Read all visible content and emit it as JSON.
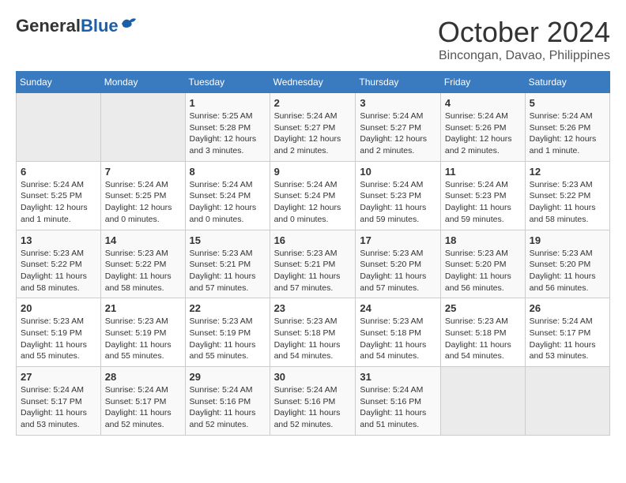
{
  "header": {
    "logo": {
      "general": "General",
      "blue": "Blue"
    },
    "title": "October 2024",
    "location": "Bincongan, Davao, Philippines"
  },
  "weekdays": [
    "Sunday",
    "Monday",
    "Tuesday",
    "Wednesday",
    "Thursday",
    "Friday",
    "Saturday"
  ],
  "weeks": [
    [
      {
        "day": "",
        "sunrise": "",
        "sunset": "",
        "daylight": "",
        "empty": true
      },
      {
        "day": "",
        "sunrise": "",
        "sunset": "",
        "daylight": "",
        "empty": true
      },
      {
        "day": "1",
        "sunrise": "Sunrise: 5:25 AM",
        "sunset": "Sunset: 5:28 PM",
        "daylight": "Daylight: 12 hours and 3 minutes.",
        "empty": false
      },
      {
        "day": "2",
        "sunrise": "Sunrise: 5:24 AM",
        "sunset": "Sunset: 5:27 PM",
        "daylight": "Daylight: 12 hours and 2 minutes.",
        "empty": false
      },
      {
        "day": "3",
        "sunrise": "Sunrise: 5:24 AM",
        "sunset": "Sunset: 5:27 PM",
        "daylight": "Daylight: 12 hours and 2 minutes.",
        "empty": false
      },
      {
        "day": "4",
        "sunrise": "Sunrise: 5:24 AM",
        "sunset": "Sunset: 5:26 PM",
        "daylight": "Daylight: 12 hours and 2 minutes.",
        "empty": false
      },
      {
        "day": "5",
        "sunrise": "Sunrise: 5:24 AM",
        "sunset": "Sunset: 5:26 PM",
        "daylight": "Daylight: 12 hours and 1 minute.",
        "empty": false
      }
    ],
    [
      {
        "day": "6",
        "sunrise": "Sunrise: 5:24 AM",
        "sunset": "Sunset: 5:25 PM",
        "daylight": "Daylight: 12 hours and 1 minute.",
        "empty": false
      },
      {
        "day": "7",
        "sunrise": "Sunrise: 5:24 AM",
        "sunset": "Sunset: 5:25 PM",
        "daylight": "Daylight: 12 hours and 0 minutes.",
        "empty": false
      },
      {
        "day": "8",
        "sunrise": "Sunrise: 5:24 AM",
        "sunset": "Sunset: 5:24 PM",
        "daylight": "Daylight: 12 hours and 0 minutes.",
        "empty": false
      },
      {
        "day": "9",
        "sunrise": "Sunrise: 5:24 AM",
        "sunset": "Sunset: 5:24 PM",
        "daylight": "Daylight: 12 hours and 0 minutes.",
        "empty": false
      },
      {
        "day": "10",
        "sunrise": "Sunrise: 5:24 AM",
        "sunset": "Sunset: 5:23 PM",
        "daylight": "Daylight: 11 hours and 59 minutes.",
        "empty": false
      },
      {
        "day": "11",
        "sunrise": "Sunrise: 5:24 AM",
        "sunset": "Sunset: 5:23 PM",
        "daylight": "Daylight: 11 hours and 59 minutes.",
        "empty": false
      },
      {
        "day": "12",
        "sunrise": "Sunrise: 5:23 AM",
        "sunset": "Sunset: 5:22 PM",
        "daylight": "Daylight: 11 hours and 58 minutes.",
        "empty": false
      }
    ],
    [
      {
        "day": "13",
        "sunrise": "Sunrise: 5:23 AM",
        "sunset": "Sunset: 5:22 PM",
        "daylight": "Daylight: 11 hours and 58 minutes.",
        "empty": false
      },
      {
        "day": "14",
        "sunrise": "Sunrise: 5:23 AM",
        "sunset": "Sunset: 5:22 PM",
        "daylight": "Daylight: 11 hours and 58 minutes.",
        "empty": false
      },
      {
        "day": "15",
        "sunrise": "Sunrise: 5:23 AM",
        "sunset": "Sunset: 5:21 PM",
        "daylight": "Daylight: 11 hours and 57 minutes.",
        "empty": false
      },
      {
        "day": "16",
        "sunrise": "Sunrise: 5:23 AM",
        "sunset": "Sunset: 5:21 PM",
        "daylight": "Daylight: 11 hours and 57 minutes.",
        "empty": false
      },
      {
        "day": "17",
        "sunrise": "Sunrise: 5:23 AM",
        "sunset": "Sunset: 5:20 PM",
        "daylight": "Daylight: 11 hours and 57 minutes.",
        "empty": false
      },
      {
        "day": "18",
        "sunrise": "Sunrise: 5:23 AM",
        "sunset": "Sunset: 5:20 PM",
        "daylight": "Daylight: 11 hours and 56 minutes.",
        "empty": false
      },
      {
        "day": "19",
        "sunrise": "Sunrise: 5:23 AM",
        "sunset": "Sunset: 5:20 PM",
        "daylight": "Daylight: 11 hours and 56 minutes.",
        "empty": false
      }
    ],
    [
      {
        "day": "20",
        "sunrise": "Sunrise: 5:23 AM",
        "sunset": "Sunset: 5:19 PM",
        "daylight": "Daylight: 11 hours and 55 minutes.",
        "empty": false
      },
      {
        "day": "21",
        "sunrise": "Sunrise: 5:23 AM",
        "sunset": "Sunset: 5:19 PM",
        "daylight": "Daylight: 11 hours and 55 minutes.",
        "empty": false
      },
      {
        "day": "22",
        "sunrise": "Sunrise: 5:23 AM",
        "sunset": "Sunset: 5:19 PM",
        "daylight": "Daylight: 11 hours and 55 minutes.",
        "empty": false
      },
      {
        "day": "23",
        "sunrise": "Sunrise: 5:23 AM",
        "sunset": "Sunset: 5:18 PM",
        "daylight": "Daylight: 11 hours and 54 minutes.",
        "empty": false
      },
      {
        "day": "24",
        "sunrise": "Sunrise: 5:23 AM",
        "sunset": "Sunset: 5:18 PM",
        "daylight": "Daylight: 11 hours and 54 minutes.",
        "empty": false
      },
      {
        "day": "25",
        "sunrise": "Sunrise: 5:23 AM",
        "sunset": "Sunset: 5:18 PM",
        "daylight": "Daylight: 11 hours and 54 minutes.",
        "empty": false
      },
      {
        "day": "26",
        "sunrise": "Sunrise: 5:24 AM",
        "sunset": "Sunset: 5:17 PM",
        "daylight": "Daylight: 11 hours and 53 minutes.",
        "empty": false
      }
    ],
    [
      {
        "day": "27",
        "sunrise": "Sunrise: 5:24 AM",
        "sunset": "Sunset: 5:17 PM",
        "daylight": "Daylight: 11 hours and 53 minutes.",
        "empty": false
      },
      {
        "day": "28",
        "sunrise": "Sunrise: 5:24 AM",
        "sunset": "Sunset: 5:17 PM",
        "daylight": "Daylight: 11 hours and 52 minutes.",
        "empty": false
      },
      {
        "day": "29",
        "sunrise": "Sunrise: 5:24 AM",
        "sunset": "Sunset: 5:16 PM",
        "daylight": "Daylight: 11 hours and 52 minutes.",
        "empty": false
      },
      {
        "day": "30",
        "sunrise": "Sunrise: 5:24 AM",
        "sunset": "Sunset: 5:16 PM",
        "daylight": "Daylight: 11 hours and 52 minutes.",
        "empty": false
      },
      {
        "day": "31",
        "sunrise": "Sunrise: 5:24 AM",
        "sunset": "Sunset: 5:16 PM",
        "daylight": "Daylight: 11 hours and 51 minutes.",
        "empty": false
      },
      {
        "day": "",
        "sunrise": "",
        "sunset": "",
        "daylight": "",
        "empty": true
      },
      {
        "day": "",
        "sunrise": "",
        "sunset": "",
        "daylight": "",
        "empty": true
      }
    ]
  ]
}
